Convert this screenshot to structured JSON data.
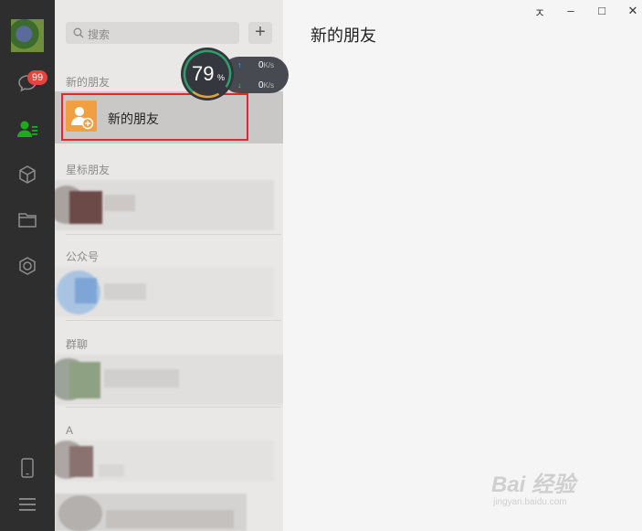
{
  "sidebar": {
    "chat_badge": "99"
  },
  "contacts": {
    "search_placeholder": "搜索",
    "add_label": "+",
    "sections": {
      "new_friends": "新的朋友",
      "starred": "星标朋友",
      "official": "公众号",
      "groups": "群聊",
      "letter_a": "A"
    },
    "new_friends_item": "新的朋友"
  },
  "main": {
    "title": "新的朋友"
  },
  "window_controls": {
    "pin": "ㅈ",
    "minimize": "–",
    "maximize": "□",
    "close": "✕"
  },
  "speed_widget": {
    "percent": "79",
    "percent_sign": "%",
    "upload": "0",
    "download": "0",
    "unit": "K/s"
  },
  "watermark": {
    "brand": "Bai 经验",
    "url": "jingyan.baidu.com"
  },
  "colors": {
    "rail": "#2e2e2e",
    "list_bg": "#e9e8e7",
    "accent_green": "#1aad19",
    "badge": "#e64340",
    "highlight": "#e5262b",
    "new_friend_icon": "#f0a043"
  }
}
